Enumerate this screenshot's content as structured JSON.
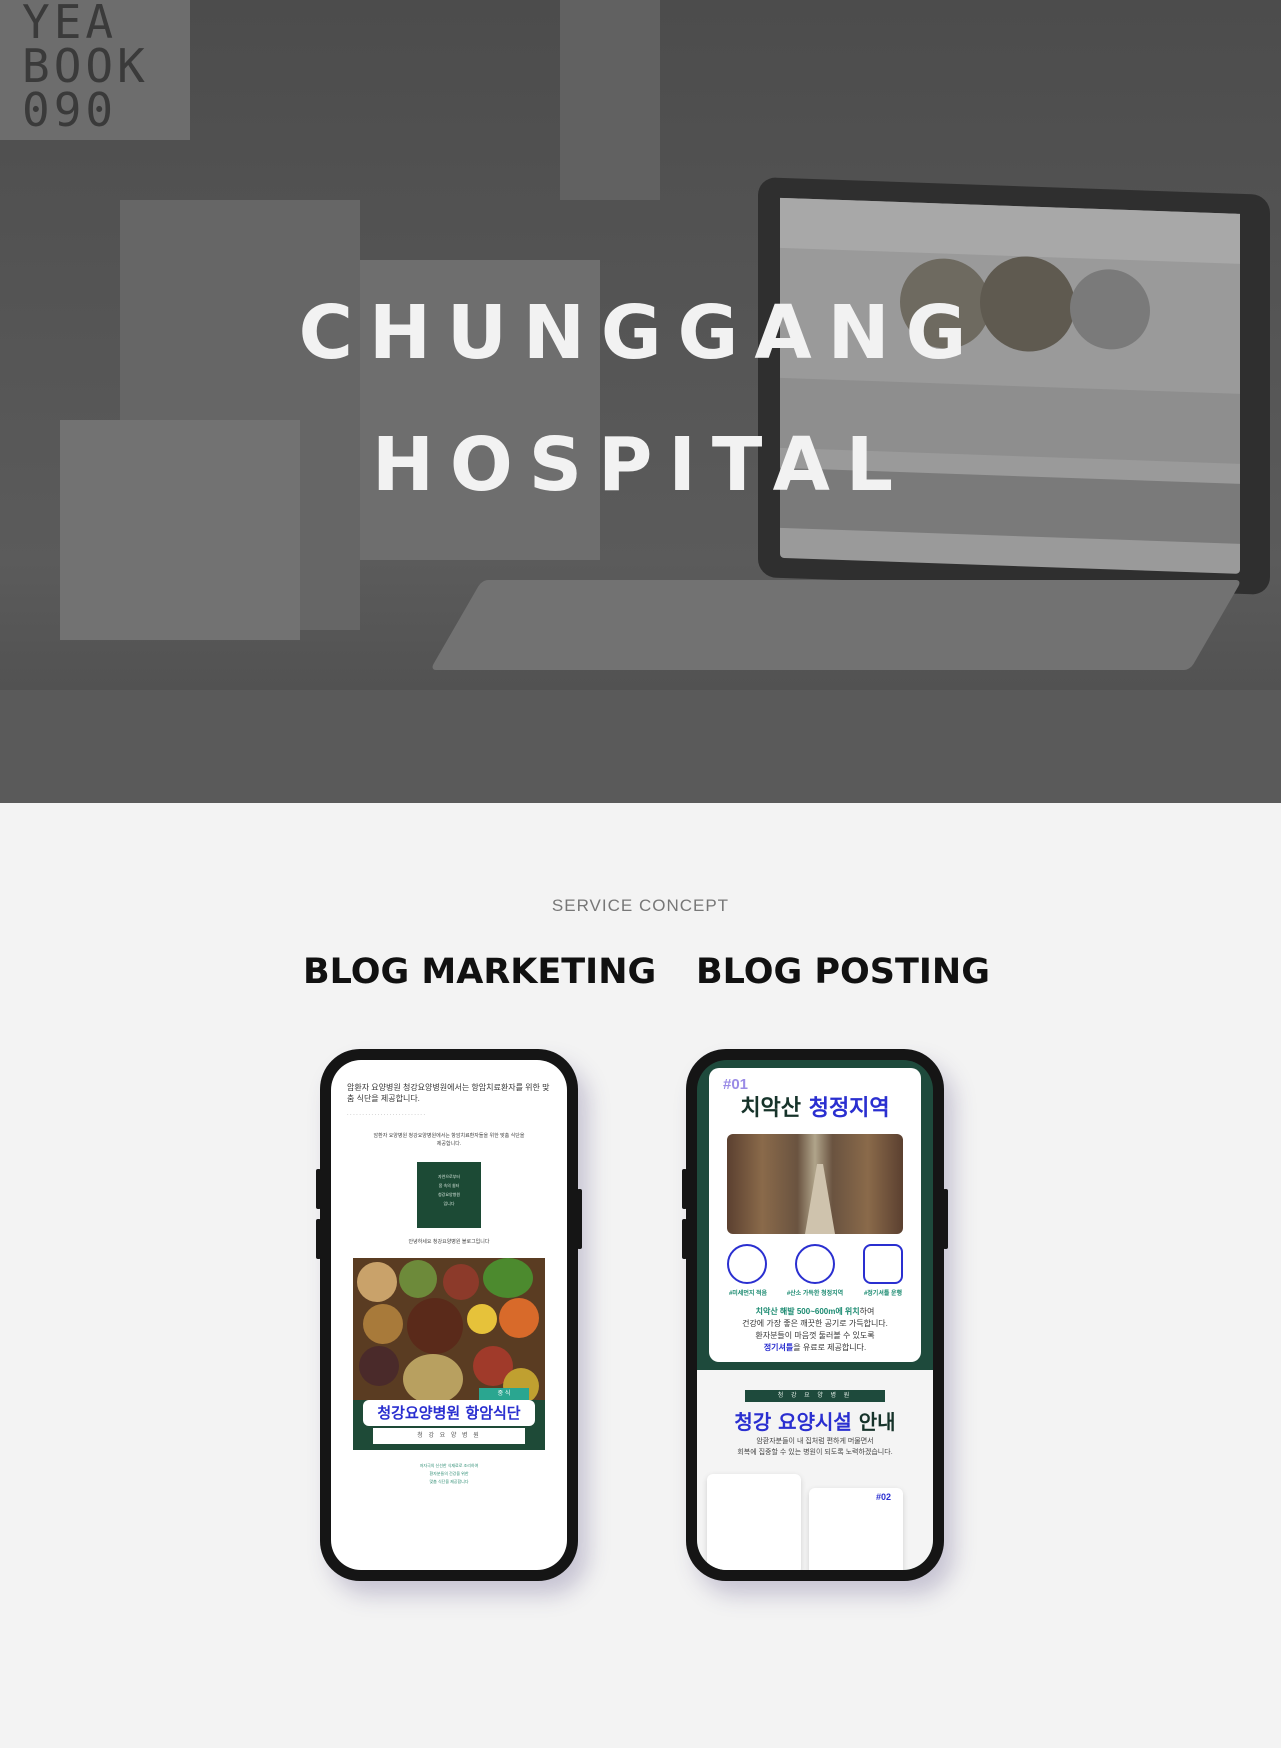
{
  "hero": {
    "title_line1": "CHUNGGANG",
    "title_line2": "HOSPITAL",
    "lightbox_lines": [
      "YEA",
      "BOOK",
      "090"
    ]
  },
  "service": {
    "label": "SERVICE CONCEPT",
    "left_title": "BLOG MARKETING",
    "right_title": "BLOG POSTING"
  },
  "phone1": {
    "headline": "암환자 요양병원 청강요양병원에서는 항암치료환자를 위한 맞춤 식단을 제공합니다.",
    "intro": "암환자 요양병원 청강요양병원에서는 항암치료환자들을 위한 맞춤 식단을 제공합니다.",
    "card_lines": [
      "자연으로부터",
      "몸 속의 쉼터",
      "청강요양병원",
      "입니다"
    ],
    "greeting": "안녕하세요 청강요양병원 블로그입니다",
    "food_tag": "중 식",
    "food_banner": "청강요양병원 항암식단",
    "food_sub": "청 강 요 양 병 원",
    "footer_lines": [
      "저자극의 신선한 식재료로 조리하여",
      "환자분들의 건강을 위한",
      "맞춤 식단을 제공합니다"
    ]
  },
  "phone2": {
    "num1": "#01",
    "title_a": "치악산 ",
    "title_b": "청정지역",
    "icon_labels": [
      "#미세먼지 적음",
      "#산소 가득한 청정지역",
      "#정기셔틀 운행"
    ],
    "body_line1_hl": "치악산 해발 500~600m에 위치",
    "body_line1_rest": "하여",
    "body_line2": "건강에 가장 좋은 깨끗한 공기로 가득합니다.",
    "body_line3": "환자분들이 마음껏 둘러볼 수 있도록",
    "body_line4_hl": "정기셔틀",
    "body_line4_rest": "을 유료로 제공합니다.",
    "bar": "청 강 요 양 병 원",
    "h2_a": "청강 요양시설 ",
    "h2_b": "안내",
    "body2_line1": "암환자분들이 내 집처럼 편하게 머물면서",
    "body2_line2": "회복에 집중할 수 있는 병원이 되도록 노력하겠습니다.",
    "num2": "#02"
  },
  "colors": {
    "brand_green": "#1e4a3c",
    "accent_blue": "#2a2fd0",
    "teal": "#1a8a70"
  }
}
